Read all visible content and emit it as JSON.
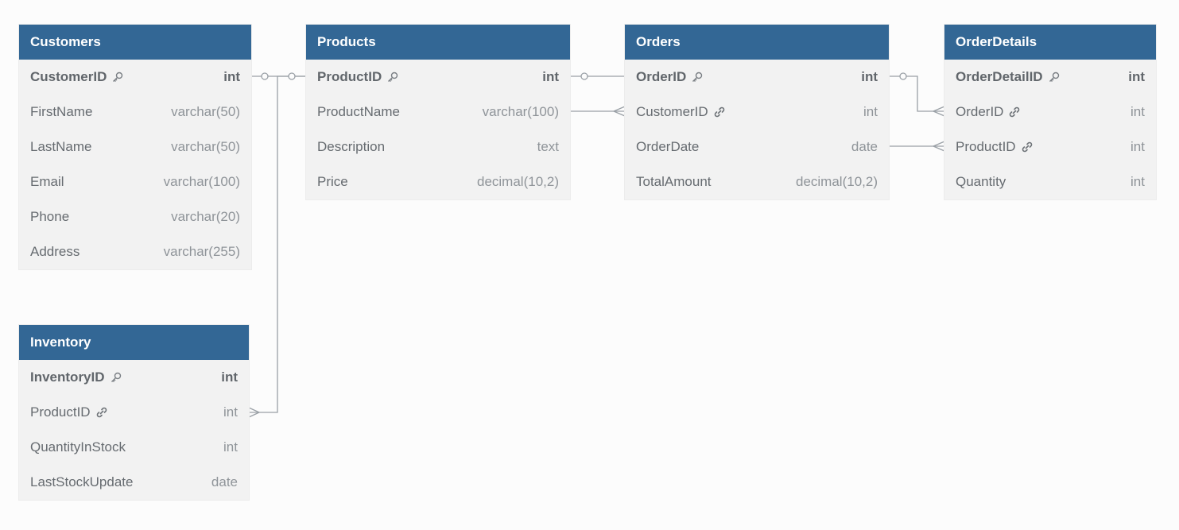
{
  "tables": [
    {
      "id": "customers",
      "name": "Customers",
      "fields": [
        {
          "name": "CustomerID",
          "type": "int",
          "pk": true,
          "icon": "key-icon"
        },
        {
          "name": "FirstName",
          "type": "varchar(50)"
        },
        {
          "name": "LastName",
          "type": "varchar(50)"
        },
        {
          "name": "Email",
          "type": "varchar(100)"
        },
        {
          "name": "Phone",
          "type": "varchar(20)"
        },
        {
          "name": "Address",
          "type": "varchar(255)"
        }
      ]
    },
    {
      "id": "products",
      "name": "Products",
      "fields": [
        {
          "name": "ProductID",
          "type": "int",
          "pk": true,
          "icon": "key-icon"
        },
        {
          "name": "ProductName",
          "type": "varchar(100)"
        },
        {
          "name": "Description",
          "type": "text"
        },
        {
          "name": "Price",
          "type": "decimal(10,2)"
        }
      ]
    },
    {
      "id": "orders",
      "name": "Orders",
      "fields": [
        {
          "name": "OrderID",
          "type": "int",
          "pk": true,
          "icon": "key-icon"
        },
        {
          "name": "CustomerID",
          "type": "int",
          "icon": "link-icon"
        },
        {
          "name": "OrderDate",
          "type": "date"
        },
        {
          "name": "TotalAmount",
          "type": "decimal(10,2)"
        }
      ]
    },
    {
      "id": "orderdetails",
      "name": "OrderDetails",
      "fields": [
        {
          "name": "OrderDetailID",
          "type": "int",
          "pk": true,
          "icon": "key-icon"
        },
        {
          "name": "OrderID",
          "type": "int",
          "icon": "link-icon"
        },
        {
          "name": "ProductID",
          "type": "int",
          "icon": "link-icon"
        },
        {
          "name": "Quantity",
          "type": "int"
        }
      ]
    },
    {
      "id": "inventory",
      "name": "Inventory",
      "fields": [
        {
          "name": "InventoryID",
          "type": "int",
          "pk": true,
          "icon": "key-icon"
        },
        {
          "name": "ProductID",
          "type": "int",
          "icon": "link-icon"
        },
        {
          "name": "QuantityInStock",
          "type": "int"
        },
        {
          "name": "LastStockUpdate",
          "type": "date"
        }
      ]
    }
  ],
  "colors": {
    "header": "#336795",
    "body": "#f2f2f2",
    "connector": "#9aa0a6"
  }
}
